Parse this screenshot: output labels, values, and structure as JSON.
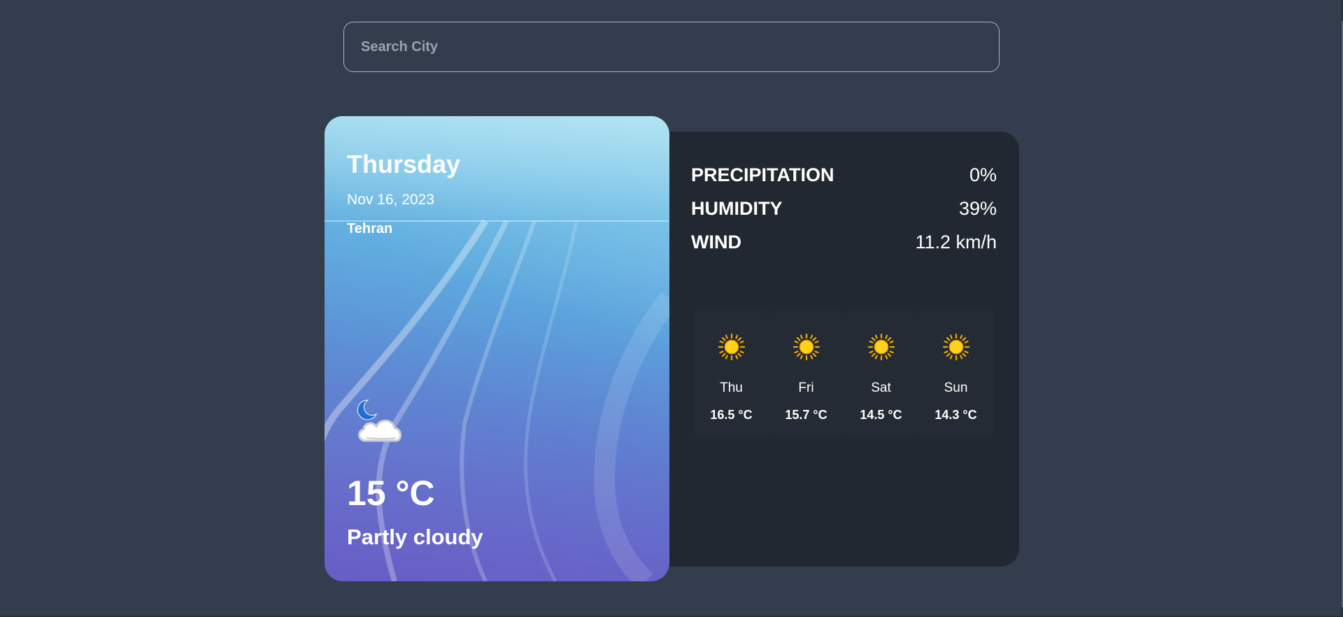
{
  "search": {
    "placeholder": "Search City",
    "value": ""
  },
  "current": {
    "day": "Thursday",
    "date": "Nov 16, 2023",
    "city": "Tehran",
    "temperature": "15 °C",
    "condition": "Partly cloudy",
    "icon": "night-cloud-icon"
  },
  "stats": [
    {
      "label": "PRECIPITATION",
      "value": "0%"
    },
    {
      "label": "HUMIDITY",
      "value": "39%"
    },
    {
      "label": "WIND",
      "value": "11.2 km/h"
    }
  ],
  "forecast": [
    {
      "day": "Thu",
      "temp": "16.5 °C",
      "icon": "sun-icon"
    },
    {
      "day": "Fri",
      "temp": "15.7 °C",
      "icon": "sun-icon"
    },
    {
      "day": "Sat",
      "temp": "14.5 °C",
      "icon": "sun-icon"
    },
    {
      "day": "Sun",
      "temp": "14.3 °C",
      "icon": "sun-icon"
    }
  ],
  "colors": {
    "background": "#343d4d",
    "panel": "#222831",
    "sun": "#f5c518"
  }
}
